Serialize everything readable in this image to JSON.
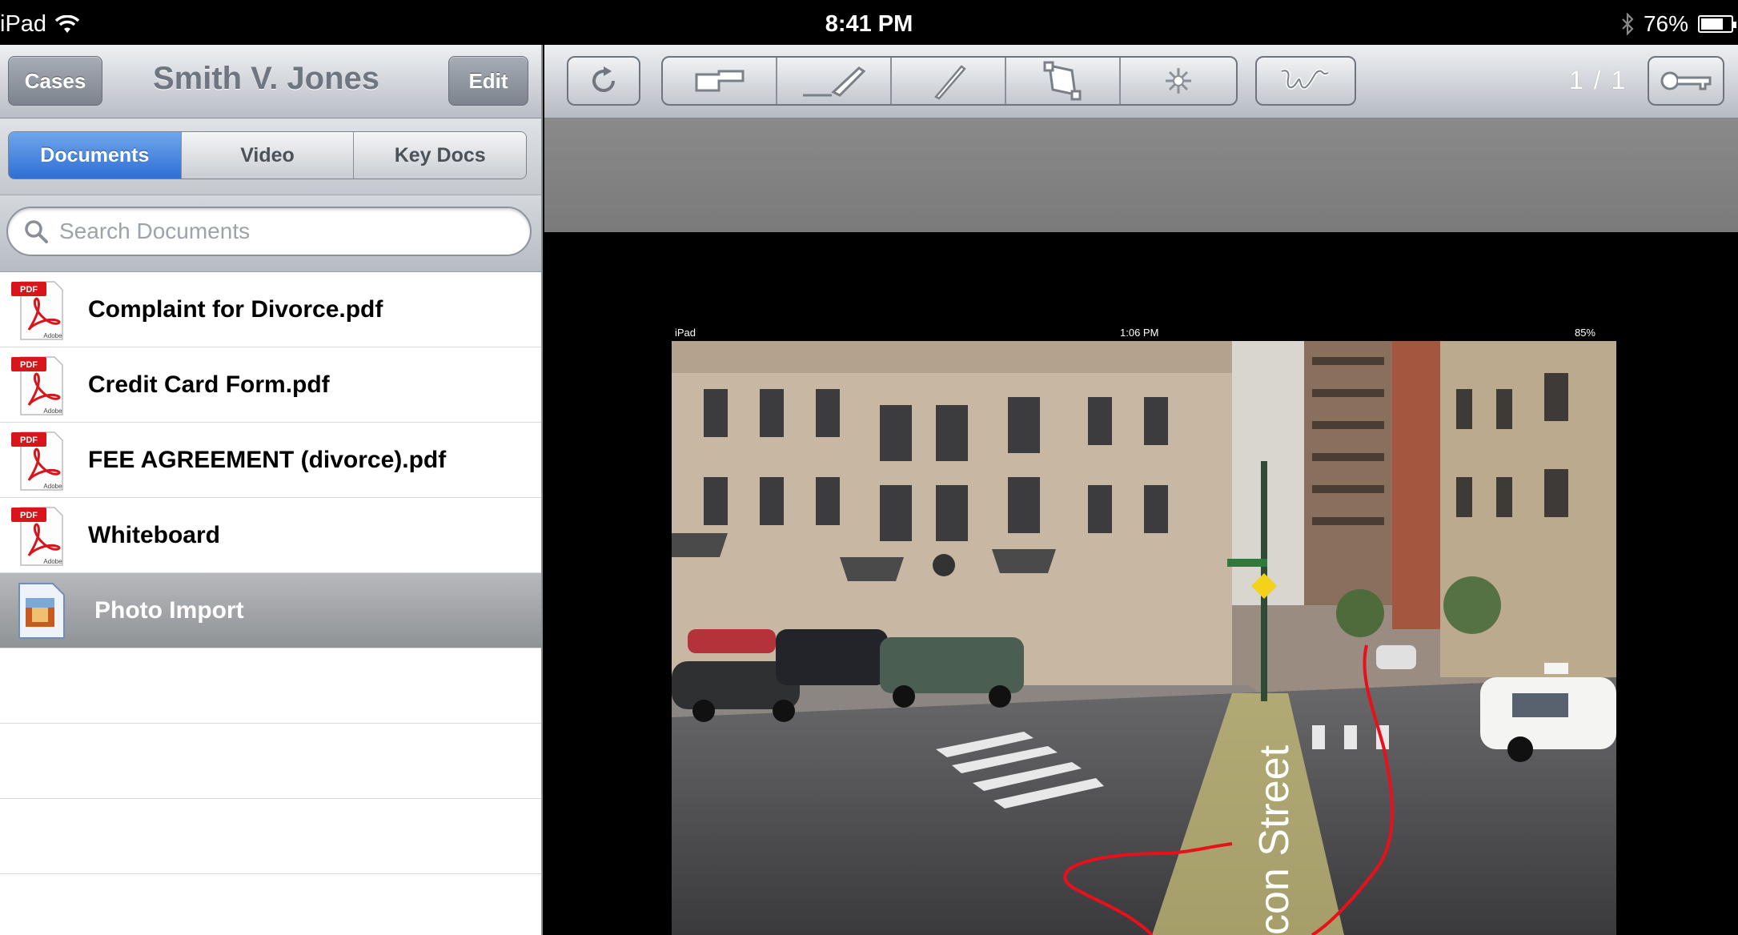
{
  "status_bar": {
    "device": "iPad",
    "time": "8:41 PM",
    "battery": "76%",
    "battery_level": 0.76
  },
  "left_nav": {
    "back_label": "Cases",
    "title": "Smith V. Jones",
    "edit_label": "Edit"
  },
  "segments": [
    {
      "label": "Documents",
      "active": true
    },
    {
      "label": "Video",
      "active": false
    },
    {
      "label": "Key Docs",
      "active": false
    }
  ],
  "search": {
    "placeholder": "Search Documents"
  },
  "documents": [
    {
      "title": "Complaint for Divorce.pdf",
      "icon": "pdf-icon",
      "pdf_badge": "PDF",
      "adobe_text": "Adobe"
    },
    {
      "title": "Credit Card Form.pdf",
      "icon": "pdf-icon",
      "pdf_badge": "PDF",
      "adobe_text": "Adobe"
    },
    {
      "title": "FEE AGREEMENT (divorce).pdf",
      "icon": "pdf-icon",
      "pdf_badge": "PDF",
      "adobe_text": "Adobe"
    },
    {
      "title": "Whiteboard",
      "icon": "pdf-icon",
      "pdf_badge": "PDF",
      "adobe_text": "Adobe"
    },
    {
      "title": "Photo Import",
      "icon": "photo-icon",
      "selected": true
    }
  ],
  "toolbar": {
    "page_indicator": "1 / 1",
    "tools": [
      "refresh-icon",
      "pointer-icon",
      "highlighter-icon",
      "pen-icon",
      "crop-icon",
      "laser-icon",
      "signature-icon",
      "key-icon"
    ]
  },
  "document_view": {
    "inner_status": {
      "device": "iPad",
      "time": "1:06 PM",
      "battery": "85%"
    },
    "street_label": "con Street"
  },
  "colors": {
    "accent_blue": "#2f6fd4",
    "annotation_red": "#e8101a"
  }
}
